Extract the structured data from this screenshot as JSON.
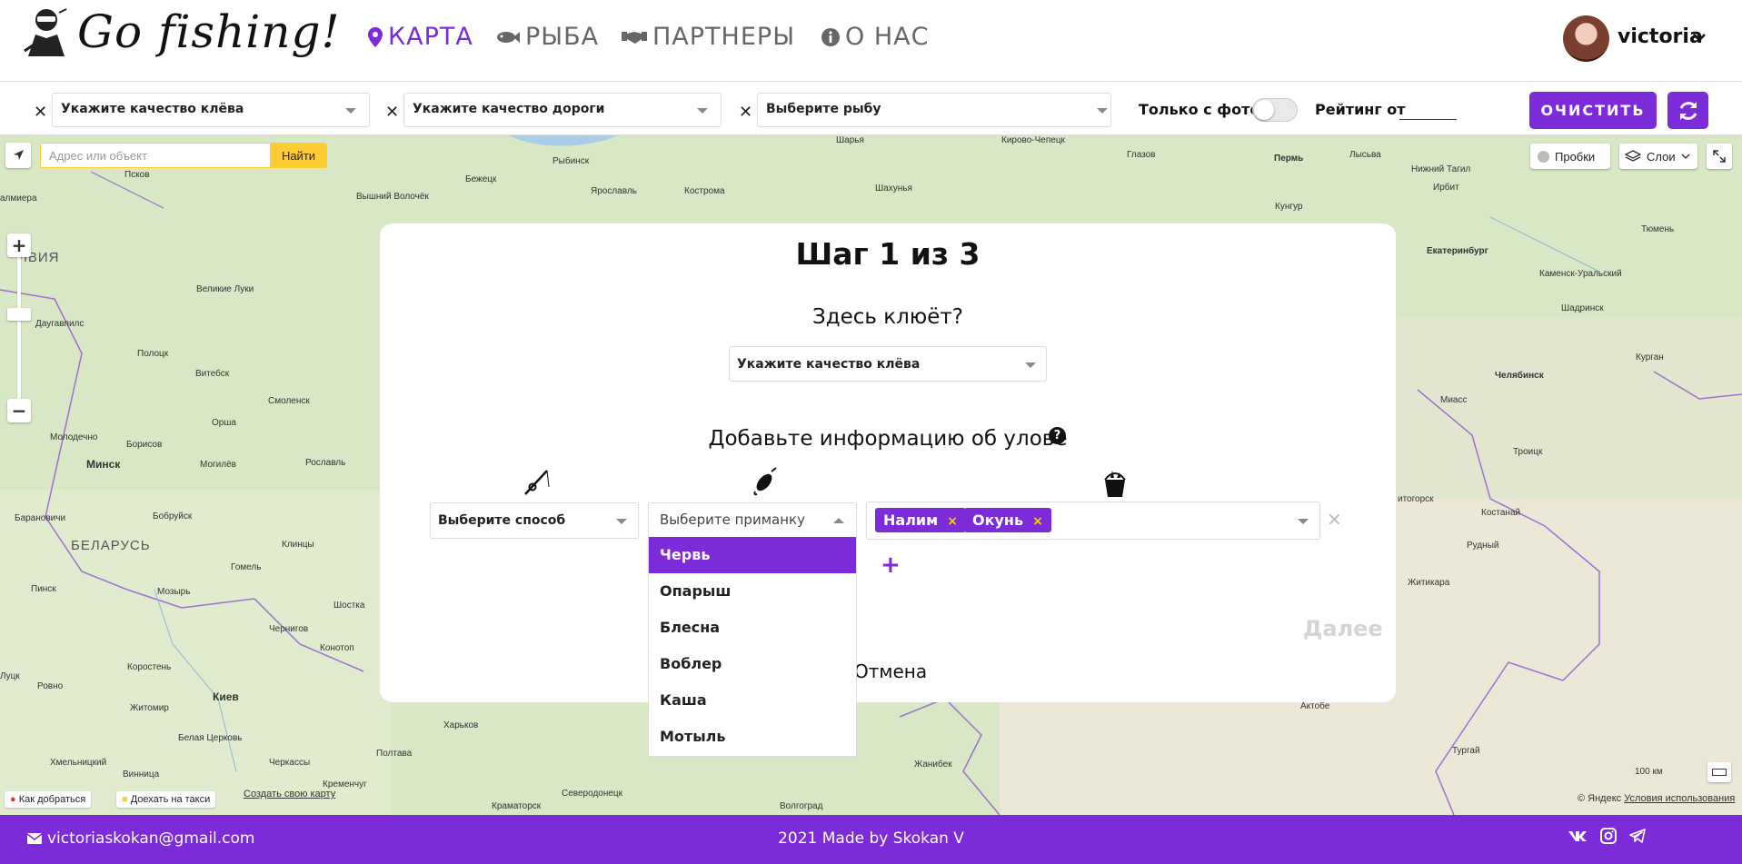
{
  "header": {
    "brand": "Go fishing!",
    "nav": [
      {
        "label": "КАРТА",
        "icon": "map-marker-icon",
        "active": true
      },
      {
        "label": "РЫБА",
        "icon": "fish-icon",
        "active": false
      },
      {
        "label": "ПАРТНЕРЫ",
        "icon": "handshake-icon",
        "active": false
      },
      {
        "label": "О НАС",
        "icon": "info-icon",
        "active": false
      }
    ],
    "user": {
      "name": "victoria"
    }
  },
  "filters": {
    "bite_placeholder": "Укажите качество клёва",
    "road_placeholder": "Укажите качество дороги",
    "fish_placeholder": "Выберите рыбу",
    "photo_only_label": "Только с фото",
    "photo_only_on": false,
    "rating_label": "Рейтинг от",
    "rating_value": "",
    "clear_label": "ОЧИСТИТЬ"
  },
  "map": {
    "search_placeholder": "Адрес или объект",
    "find_label": "Найти",
    "traffic_label": "Пробки",
    "layers_label": "Слои",
    "route_label": "Как добраться",
    "taxi_label": "Доехать на такси",
    "create_map_label": "Создать свою карту",
    "scale_label": "100 км",
    "copyright": "© Яндекс",
    "terms_label": "Условия использования",
    "cities": [
      {
        "name": "Псков"
      },
      {
        "name": "Бежецк"
      },
      {
        "name": "Рыбинск"
      },
      {
        "name": "Ярославль"
      },
      {
        "name": "Кострома"
      },
      {
        "name": "Вышний Волочёк"
      },
      {
        "name": "Шахунья"
      },
      {
        "name": "Шарья"
      },
      {
        "name": "Кирово-Чепецк"
      },
      {
        "name": "Глазов"
      },
      {
        "name": "Пермь"
      },
      {
        "name": "Лысьва"
      },
      {
        "name": "Нижний Тагил"
      },
      {
        "name": "Ирбит"
      },
      {
        "name": "Кунгур"
      },
      {
        "name": "Екатеринбург"
      },
      {
        "name": "Тюмень"
      },
      {
        "name": "Каменск-Уральский"
      },
      {
        "name": "Шадринск"
      },
      {
        "name": "Курган"
      },
      {
        "name": "Челябинск"
      },
      {
        "name": "Миасс"
      },
      {
        "name": "Троицк"
      },
      {
        "name": "Великие Луки"
      },
      {
        "name": "Даугавпилс"
      },
      {
        "name": "Полоцк"
      },
      {
        "name": "Витебск"
      },
      {
        "name": "Смоленск"
      },
      {
        "name": "Орша"
      },
      {
        "name": "Молодечно"
      },
      {
        "name": "Борисов"
      },
      {
        "name": "Минск"
      },
      {
        "name": "Могилёв"
      },
      {
        "name": "Рославль"
      },
      {
        "name": "Барановичи"
      },
      {
        "name": "Бобруйск"
      },
      {
        "name": "Клинцы"
      },
      {
        "name": "Пинск"
      },
      {
        "name": "Мозырь"
      },
      {
        "name": "Гомель"
      },
      {
        "name": "Шостка"
      },
      {
        "name": "Чернигов"
      },
      {
        "name": "Конотоп"
      },
      {
        "name": "Луцк"
      },
      {
        "name": "Ровно"
      },
      {
        "name": "Коростень"
      },
      {
        "name": "Житомир"
      },
      {
        "name": "Киев"
      },
      {
        "name": "Харьков"
      },
      {
        "name": "Полтава"
      },
      {
        "name": "Белая Церковь"
      },
      {
        "name": "Хмельницкий"
      },
      {
        "name": "Винница"
      },
      {
        "name": "Черкассы"
      },
      {
        "name": "Кременчуг"
      },
      {
        "name": "Северодонецк"
      },
      {
        "name": "Краматорск"
      },
      {
        "name": "Волгоград"
      },
      {
        "name": "Жанибек"
      },
      {
        "name": "Актобе"
      },
      {
        "name": "Тургай"
      },
      {
        "name": "Житикара"
      },
      {
        "name": "Рудный"
      },
      {
        "name": "Костанай"
      },
      {
        "name": "итогорск"
      },
      {
        "name": "алмиера"
      }
    ],
    "regions": [
      {
        "name": "БЕЛАРУСЬ"
      },
      {
        "name": "ЛВИЯ"
      }
    ]
  },
  "modal": {
    "title": "Шаг 1 из 3",
    "question1": "Здесь клюёт?",
    "bite_placeholder": "Укажите качество клёва",
    "question2": "Добавьте информацию об улове",
    "help": "?",
    "method_placeholder": "Выберите способ",
    "bait_placeholder": "Выберите приманку",
    "tags": [
      {
        "label": "Налим"
      },
      {
        "label": "Окунь"
      }
    ],
    "remove_tag": "×",
    "remove_row": "×",
    "add_row": "+",
    "next_label": "Далее",
    "cancel_label": "Отмена",
    "bait_options": [
      {
        "label": "Червь",
        "highlighted": true
      },
      {
        "label": "Опарыш",
        "highlighted": false
      },
      {
        "label": "Блесна",
        "highlighted": false
      },
      {
        "label": "Воблер",
        "highlighted": false
      },
      {
        "label": "Каша",
        "highlighted": false
      },
      {
        "label": "Мотыль",
        "highlighted": false
      }
    ]
  },
  "footer": {
    "email": "victoriaskokan@gmail.com",
    "made_by": "2021 Made by Skokan V",
    "social": [
      {
        "icon": "vk-icon"
      },
      {
        "icon": "instagram-icon"
      },
      {
        "icon": "telegram-icon"
      }
    ]
  },
  "colors": {
    "accent": "#7c2bd8",
    "map_land": "#d8e7c4",
    "map_yellow": "#ffcc33",
    "next_disabled": "#d5d5d5"
  }
}
